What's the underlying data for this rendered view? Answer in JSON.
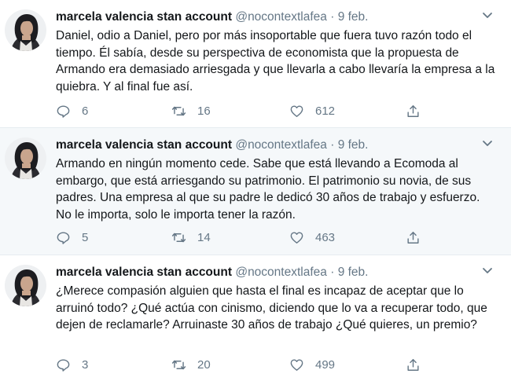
{
  "tweets": [
    {
      "name": "marcela valencia stan account",
      "handle": "@nocontextlafea",
      "dot": "·",
      "date": "9 feb.",
      "text": "Daniel, odio a Daniel, pero por más insoportable que fuera tuvo razón todo el tiempo. Él sabía, desde su perspectiva de economista que la propuesta de Armando era demasiado arriesgada y que llevarla a cabo llevaría la empresa a la quiebra. Y al final fue así.",
      "replies": "6",
      "retweets": "16",
      "likes": "612"
    },
    {
      "name": "marcela valencia stan account",
      "handle": "@nocontextlafea",
      "dot": "·",
      "date": "9 feb.",
      "text": "Armando en ningún momento cede. Sabe que está llevando a Ecomoda al embargo, que está arriesgando su patrimonio. El patrimonio su novia, de sus padres. Una empresa al que su padre le dedicó 30 años de trabajo y esfuerzo. No le importa, solo le importa tener la razón.",
      "replies": "5",
      "retweets": "14",
      "likes": "463"
    },
    {
      "name": "marcela valencia stan account",
      "handle": "@nocontextlafea",
      "dot": "·",
      "date": "9 feb.",
      "text": "¿Merece compasión alguien que hasta el final es incapaz de aceptar que lo arruinó todo? ¿Qué actúa con cinismo, diciendo que lo va a recuperar todo, que dejen de reclamarle? Arruinaste 30 años de trabajo ¿Qué quieres, un premio?",
      "replies": "3",
      "retweets": "20",
      "likes": "499"
    }
  ],
  "icons": {
    "reply": "reply-icon",
    "retweet": "retweet-icon",
    "like": "heart-icon",
    "share": "share-icon",
    "caret": "chevron-down-icon"
  },
  "colors": {
    "text": "#14171a",
    "secondary": "#657786",
    "hover_background": "#f5f8fa",
    "divider": "#e6ecf0"
  }
}
